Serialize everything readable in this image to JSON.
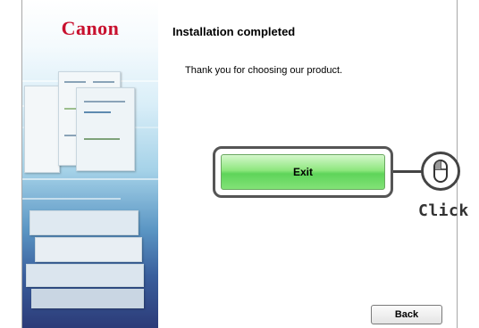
{
  "brand": {
    "logo_text": "Canon",
    "logo_color": "#c8102e"
  },
  "page": {
    "title": "Installation completed",
    "message": "Thank you for choosing our product."
  },
  "buttons": {
    "exit_label": "Exit",
    "back_label": "Back"
  },
  "annotation": {
    "click_label": "Click",
    "icon": "mouse-icon"
  },
  "colors": {
    "exit_button": "#6fdc63",
    "highlight_border": "#555555"
  }
}
